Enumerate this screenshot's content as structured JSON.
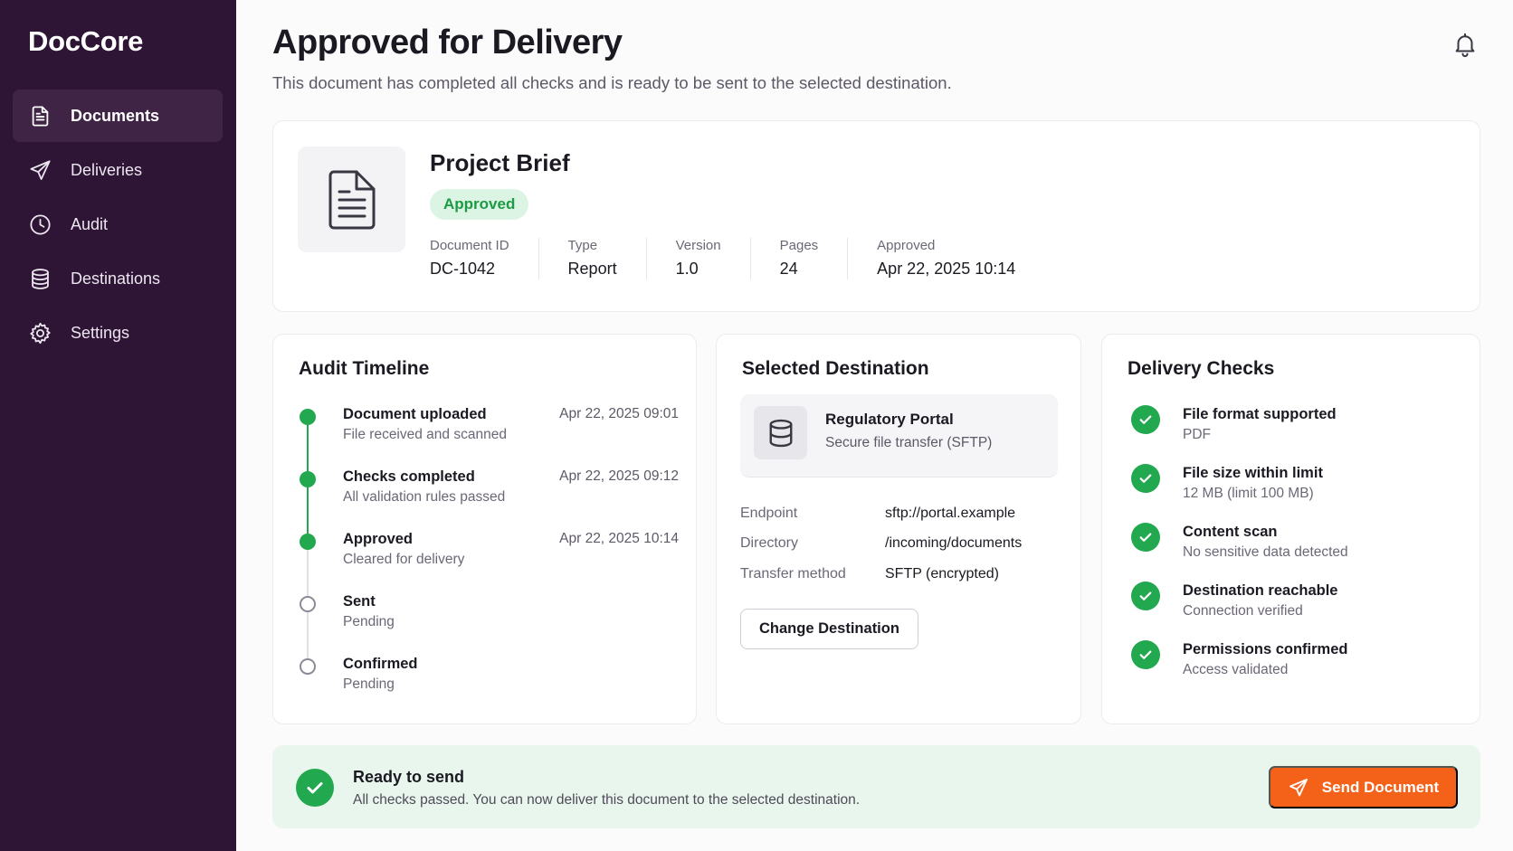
{
  "app": {
    "brand": "DocCore"
  },
  "sidebar": {
    "items": [
      {
        "label": "Documents",
        "icon": "document-icon",
        "active": true
      },
      {
        "label": "Deliveries",
        "icon": "send-icon",
        "active": false
      },
      {
        "label": "Audit",
        "icon": "clock-icon",
        "active": false
      },
      {
        "label": "Destinations",
        "icon": "database-icon",
        "active": false
      },
      {
        "label": "Settings",
        "icon": "gear-icon",
        "active": false
      }
    ]
  },
  "header": {
    "title": "Approved for Delivery",
    "subtitle": "This document has completed all checks and is ready to be sent to the selected destination.",
    "icon": "bell-icon"
  },
  "document": {
    "title": "Project Brief",
    "status": "Approved",
    "meta": [
      {
        "label": "Document ID",
        "value": "DC-1042"
      },
      {
        "label": "Type",
        "value": "Report"
      },
      {
        "label": "Version",
        "value": "1.0"
      },
      {
        "label": "Pages",
        "value": "24"
      },
      {
        "label": "Approved",
        "value": "Apr 22, 2025 10:14"
      }
    ]
  },
  "audit": {
    "heading": "Audit Timeline",
    "events": [
      {
        "title": "Document uploaded",
        "desc": "File received and scanned",
        "time": "Apr 22, 2025 09:01",
        "done": true
      },
      {
        "title": "Checks completed",
        "desc": "All validation rules passed",
        "time": "Apr 22, 2025 09:12",
        "done": true
      },
      {
        "title": "Approved",
        "desc": "Cleared for delivery",
        "time": "Apr 22, 2025 10:14",
        "done": true
      },
      {
        "title": "Sent",
        "desc": "Pending",
        "time": "",
        "done": false
      },
      {
        "title": "Confirmed",
        "desc": "Pending",
        "time": "",
        "done": false
      }
    ]
  },
  "destination": {
    "heading": "Selected Destination",
    "name": "Regulatory Portal",
    "protocol": "Secure file transfer (SFTP)",
    "details": [
      {
        "label": "Endpoint",
        "value": "sftp://portal.example"
      },
      {
        "label": "Directory",
        "value": "/incoming/documents"
      },
      {
        "label": "Transfer method",
        "value": "SFTP (encrypted)"
      }
    ],
    "change_label": "Change Destination"
  },
  "checks": {
    "heading": "Delivery Checks",
    "items": [
      {
        "title": "File format supported",
        "desc": "PDF"
      },
      {
        "title": "File size within limit",
        "desc": "12 MB (limit 100 MB)"
      },
      {
        "title": "Content scan",
        "desc": "No sensitive data detected"
      },
      {
        "title": "Destination reachable",
        "desc": "Connection verified"
      },
      {
        "title": "Permissions confirmed",
        "desc": "Access validated"
      }
    ]
  },
  "ready": {
    "title": "Ready to send",
    "desc": "All checks passed. You can now deliver this document to the selected destination.",
    "send_label": "Send Document"
  },
  "colors": {
    "sidebar": "#2e1435",
    "success": "#22a84e",
    "accent": "#f4621a"
  }
}
